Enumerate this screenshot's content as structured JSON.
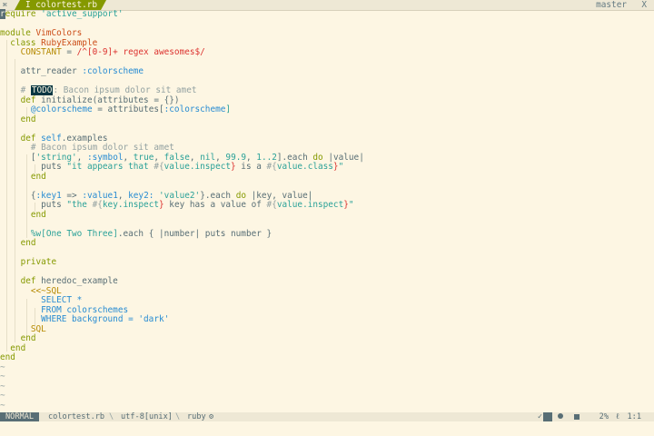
{
  "tabline": {
    "left_icon": "⌘",
    "tab_label": "I colortest.rb",
    "branch": "master",
    "close": "X"
  },
  "code": {
    "lines": [
      [
        "require ",
        "'active_support'"
      ],
      [],
      [
        "module ",
        "VimColors"
      ],
      [
        "  class ",
        "RubyExample"
      ],
      [
        "    CONSTANT",
        " = ",
        "/^[0-9]+ regex awesomes$/"
      ],
      [],
      [
        "    attr_reader ",
        ":colorscheme"
      ],
      [],
      [
        "    # ",
        "TODO",
        ": Bacon ipsum dolor sit amet"
      ],
      [
        "    def ",
        "initialize(attributes = {})"
      ],
      [
        "      ",
        "@colorscheme",
        " = attributes[",
        ":colorscheme",
        "]"
      ],
      [
        "    end"
      ],
      [],
      [
        "    def ",
        "self",
        ".examples"
      ],
      [
        "      # Bacon ipsum dolor sit amet"
      ],
      [
        "      [",
        "'string'",
        ", ",
        ":symbol",
        ", ",
        "true",
        ", ",
        "false",
        ", ",
        "nil",
        ", ",
        "99.9",
        ", ",
        "1..2",
        "].each ",
        "do",
        " |value|"
      ],
      [
        "        puts ",
        "\"it appears that ",
        "#{",
        "value.inspect",
        "}",
        " is a ",
        "#{",
        "value.class",
        "}",
        "\""
      ],
      [
        "      end"
      ],
      [],
      [
        "      {",
        ":key1",
        " => ",
        ":value1",
        ", ",
        "key2:",
        " ",
        "'value2'",
        "}.each ",
        "do",
        " |key, value|"
      ],
      [
        "        puts ",
        "\"the ",
        "#{",
        "key.inspect",
        "}",
        " key has a value of ",
        "#{",
        "value.inspect",
        "}",
        "\""
      ],
      [
        "      end"
      ],
      [],
      [
        "      ",
        "%w[",
        "One Two Three",
        "]",
        ".each { |number| puts number }"
      ],
      [
        "    end"
      ],
      [],
      [
        "    private"
      ],
      [],
      [
        "    def ",
        "heredoc_example"
      ],
      [
        "      <<~SQL"
      ],
      [
        "        SELECT *"
      ],
      [
        "        FROM colorschemes"
      ],
      [
        "        WHERE background = 'dark'"
      ],
      [
        "      SQL"
      ],
      [
        "    end"
      ],
      [
        "  end"
      ],
      [
        "end"
      ],
      [
        "~"
      ],
      [
        "~"
      ],
      [
        "~"
      ],
      [
        "~"
      ],
      [
        "~"
      ]
    ]
  },
  "statusline": {
    "mode": "NORMAL",
    "filename": "colortest.rb",
    "encoding": "utf-8[unix]",
    "filetype": "ruby",
    "percent": "2%",
    "line_icon": "ℓ",
    "position": "1:1"
  },
  "colors": {
    "background": "#fdf6e3",
    "foreground": "#586e75",
    "keyword": "#859900",
    "string": "#2aa198",
    "symbol": "#268bd2",
    "class": "#cb4b16",
    "constant": "#b58900",
    "comment": "#93a1a1"
  },
  "icons": {
    "tab_left": "command-icon",
    "filetype": "ruby-icon",
    "check": "check-icon"
  }
}
